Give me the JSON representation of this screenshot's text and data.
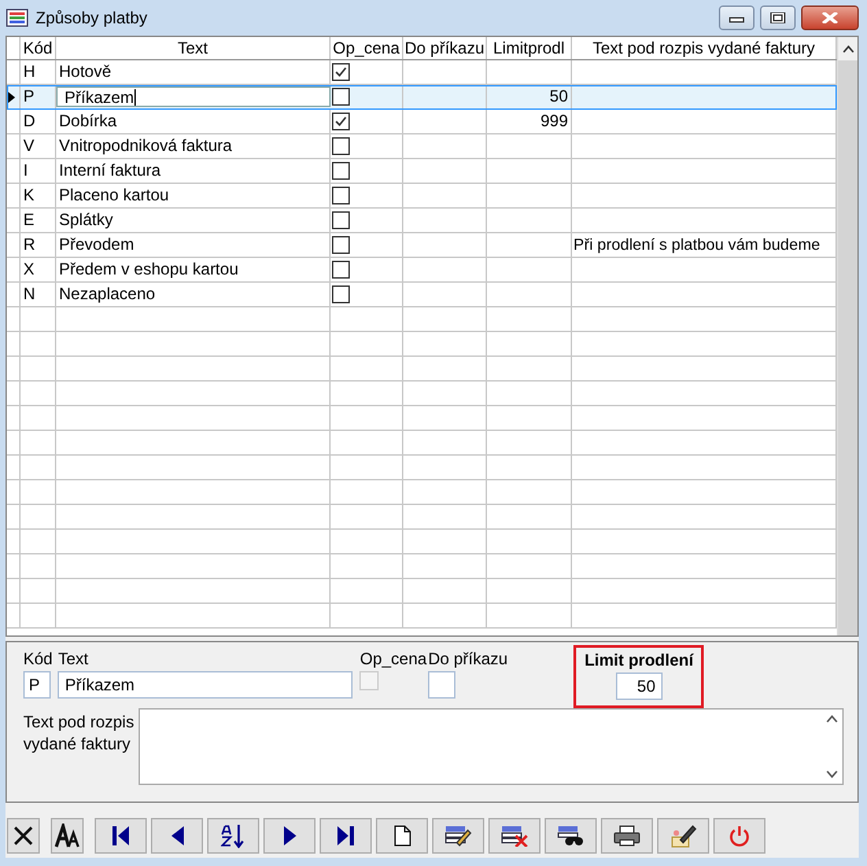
{
  "window": {
    "title": "Způsoby platby"
  },
  "table": {
    "columns": [
      "Kód",
      "Text",
      "Op_cena",
      "Do příkazu",
      "Limitprodl",
      "Text pod rozpis vydané faktury"
    ],
    "rows": [
      {
        "code": "H",
        "text": "Hotově",
        "op_cena": true,
        "limit": "",
        "note": "",
        "selected": false
      },
      {
        "code": "P",
        "text": "Příkazem",
        "op_cena": false,
        "limit": "50",
        "note": "",
        "selected": true
      },
      {
        "code": "D",
        "text": "Dobírka",
        "op_cena": true,
        "limit": "999",
        "note": "",
        "selected": false
      },
      {
        "code": "V",
        "text": "Vnitropodniková faktura",
        "op_cena": false,
        "limit": "",
        "note": "",
        "selected": false
      },
      {
        "code": "I",
        "text": "Interní faktura",
        "op_cena": false,
        "limit": "",
        "note": "",
        "selected": false
      },
      {
        "code": "K",
        "text": "Placeno kartou",
        "op_cena": false,
        "limit": "",
        "note": "",
        "selected": false
      },
      {
        "code": "E",
        "text": "Splátky",
        "op_cena": false,
        "limit": "",
        "note": "",
        "selected": false
      },
      {
        "code": "R",
        "text": "Převodem",
        "op_cena": false,
        "limit": "",
        "note": "Při prodlení s platbou vám budeme",
        "selected": false
      },
      {
        "code": "X",
        "text": "Předem v eshopu kartou",
        "op_cena": false,
        "limit": "",
        "note": "",
        "selected": false
      },
      {
        "code": "N",
        "text": "Nezaplaceno",
        "op_cena": false,
        "limit": "",
        "note": "",
        "selected": false
      }
    ]
  },
  "form": {
    "code_label": "Kód",
    "code": "P",
    "text_label": "Text",
    "text": "Příkazem",
    "op_cena_label": "Op_cena",
    "op_cena_checked": false,
    "op_cena_disabled": true,
    "do_prikazu_label": "Do příkazu",
    "limit_label": "Limit prodlení",
    "limit": "50",
    "limit_highlighted": true,
    "note_label": "Text pod rozpis vydané faktury"
  },
  "toolbar": [
    {
      "kind": "cancel"
    },
    {
      "kind": "font"
    },
    {
      "kind": "first"
    },
    {
      "kind": "prev"
    },
    {
      "kind": "sort"
    },
    {
      "kind": "next"
    },
    {
      "kind": "last"
    },
    {
      "kind": "new"
    },
    {
      "kind": "edit"
    },
    {
      "kind": "delete"
    },
    {
      "kind": "find"
    },
    {
      "kind": "print"
    },
    {
      "kind": "tools"
    },
    {
      "kind": "power"
    }
  ]
}
